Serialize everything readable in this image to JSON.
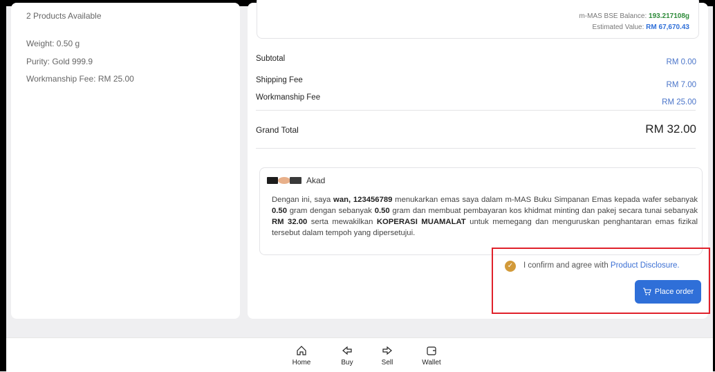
{
  "product": {
    "available": "2 Products Available",
    "weight": "Weight: 0.50 g",
    "purity": "Purity: Gold 999.9",
    "workmanship": "Workmanship Fee: RM 25.00"
  },
  "balance": {
    "label": "m-MAS BSE Balance:",
    "value": "193.217108g",
    "estimated_label": "Estimated Value:",
    "estimated_value": "RM 67,670.43"
  },
  "summary": {
    "subtotal_label": "Subtotal",
    "subtotal_value": "RM 0.00",
    "shipping_label": "Shipping Fee",
    "shipping_value": "RM 7.00",
    "workmanship_label": "Workmanship Fee",
    "workmanship_value": "RM 25.00",
    "grand_label": "Grand Total",
    "grand_value": "RM 32.00"
  },
  "akad": {
    "title": "Akad",
    "t1": "Dengan ini, saya ",
    "name": "wan, 123456789",
    "t2": " menukarkan emas saya dalam m-MAS Buku Simpanan Emas kepada wafer sebanyak ",
    "q1": "0.50",
    "t3": " gram dengan sebanyak ",
    "q2": "0.50",
    "t4": " gram dan membuat pembayaran kos khidmat minting dan pakej secara tunai sebanyak ",
    "amount": "RM 32.00",
    "t5": " serta mewakilkan ",
    "coop": "KOPERASI MUAMALAT",
    "t6": " untuk memegang dan menguruskan penghantaran emas fizikal tersebut dalam tempoh yang dipersetujui."
  },
  "confirm": {
    "text": "I confirm and agree with ",
    "link": "Product Disclosure."
  },
  "place_order": "Place order",
  "nav": {
    "home": "Home",
    "buy": "Buy",
    "sell": "Sell",
    "wallet": "Wallet"
  },
  "colors": {
    "accent": "#2f6fd8",
    "balance_green": "#2e8b3a",
    "checkbox": "#d29a3a",
    "highlight": "#e0202a"
  }
}
